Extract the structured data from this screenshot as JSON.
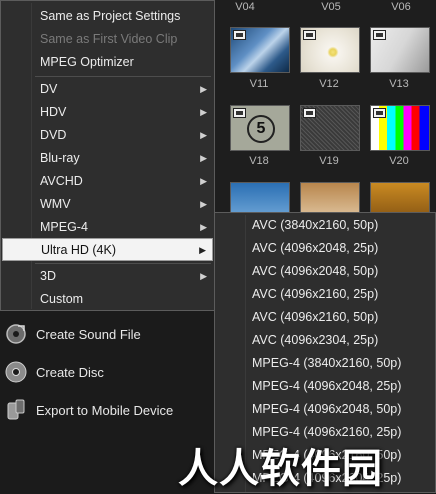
{
  "library": {
    "labels_top": [
      "V04",
      "V05",
      "V06"
    ],
    "labels_row1": [
      "V11",
      "V12",
      "V13"
    ],
    "labels_row2": [
      "V18",
      "V19",
      "V20"
    ],
    "countdown_number": "5"
  },
  "menu": {
    "items": [
      {
        "label": "Same as Project Settings",
        "enabled": true
      },
      {
        "label": "Same as First Video Clip",
        "enabled": false
      },
      {
        "label": "MPEG Optimizer",
        "enabled": true
      },
      {
        "label": "DV",
        "submenu": true
      },
      {
        "label": "HDV",
        "submenu": true
      },
      {
        "label": "DVD",
        "submenu": true
      },
      {
        "label": "Blu-ray",
        "submenu": true
      },
      {
        "label": "AVCHD",
        "submenu": true
      },
      {
        "label": "WMV",
        "submenu": true
      },
      {
        "label": "MPEG-4",
        "submenu": true
      },
      {
        "label": "Ultra HD (4K)",
        "submenu": true,
        "highlighted": true
      },
      {
        "label": "3D",
        "submenu": true
      },
      {
        "label": "Custom",
        "submenu": false
      }
    ]
  },
  "submenu": {
    "items": [
      "AVC (3840x2160, 50p)",
      "AVC (4096x2048, 25p)",
      "AVC (4096x2048, 50p)",
      "AVC (4096x2160, 25p)",
      "AVC (4096x2160, 50p)",
      "AVC (4096x2304, 25p)",
      "MPEG-4 (3840x2160, 50p)",
      "MPEG-4 (4096x2048, 25p)",
      "MPEG-4 (4096x2048, 50p)",
      "MPEG-4 (4096x2160, 25p)",
      "MPEG-4 (4096x2160, 50p)",
      "MPEG-4 (4096x2304, 25p)"
    ]
  },
  "left_panel": {
    "items": [
      {
        "label": "Create Sound File",
        "icon": "sound-file-icon"
      },
      {
        "label": "Create Disc",
        "icon": "disc-icon"
      },
      {
        "label": "Export to Mobile Device",
        "icon": "mobile-device-icon"
      }
    ]
  },
  "watermark": "人人软件园",
  "colors": {
    "menu_bg": "#2e2e2e",
    "highlight_bg": "#f3f3f3",
    "page_bg": "#1b1b1b"
  }
}
